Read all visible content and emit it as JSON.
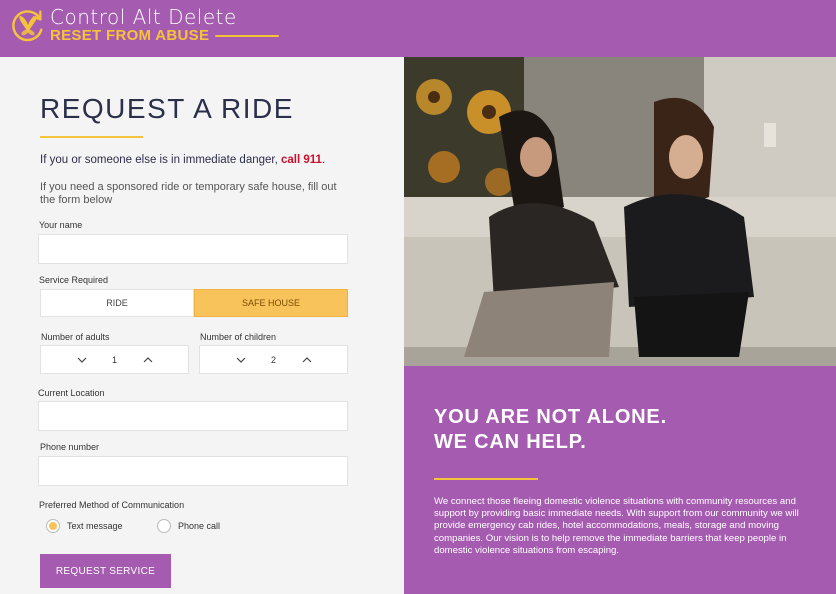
{
  "brand": {
    "title": "Control Alt Delete",
    "subtitle": "RESET FROM ABUSE",
    "colors": {
      "purple": "#a55cb0",
      "gold": "#f5c33a",
      "navy": "#2b2f4a",
      "danger": "#c8102e"
    }
  },
  "form": {
    "title": "REQUEST A RIDE",
    "danger_prefix": "If you or someone else is in immediate danger, ",
    "danger_link": "call 911",
    "danger_suffix": ".",
    "intro": "If you need a sponsored ride or temporary safe house, fill out the form below",
    "name_label": "Your name",
    "name_value": "",
    "service_label": "Service Required",
    "service_options": [
      "RIDE",
      "SAFE HOUSE"
    ],
    "service_selected": "SAFE HOUSE",
    "adults_label": "Number of adults",
    "adults_value": "1",
    "children_label": "Number of children",
    "children_value": "2",
    "location_label": "Current Location",
    "location_value": "",
    "phone_label": "Phone number",
    "phone_value": "",
    "comm_label": "Preferred Method of Communication",
    "comm_options": [
      "Text message",
      "Phone call"
    ],
    "comm_selected": "Text message",
    "submit_label": "REQUEST SERVICE"
  },
  "panel": {
    "heading_line1": "YOU ARE NOT ALONE.",
    "heading_line2": "WE CAN HELP.",
    "body": "We connect those fleeing domestic violence situations with community resources and support by providing basic immediate needs. With support from our community we will provide emergency cab rides, hotel accommodations, meals, storage and moving companies. Our vision is to help remove the immediate barriers that keep people in domestic violence situations from escaping."
  },
  "icons": {
    "logo": "butterfly-reset-icon",
    "stepper_decrement": "chevron-down-icon",
    "stepper_increment": "chevron-up-icon"
  }
}
